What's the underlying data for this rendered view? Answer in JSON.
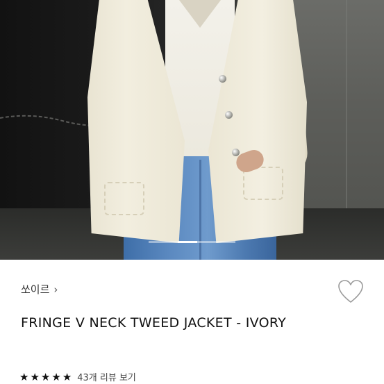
{
  "product": {
    "brand_label": "쏘이르",
    "brand_chevron": "›",
    "title": "FRINGE V NECK TWEED JACKET - IVORY",
    "rating_value": 5,
    "stars": [
      "★",
      "★",
      "★",
      "★",
      "★"
    ],
    "reviews_label": "43개 리뷰 보기"
  },
  "image_carousel": {
    "progress": 0.22
  },
  "icons": {
    "wishlist": "heart-outline-icon",
    "brand_chevron": "chevron-right-icon",
    "star": "star-filled-icon"
  },
  "colors": {
    "text_primary": "#111111",
    "text_secondary": "#333333",
    "heart_stroke": "#9a9a9a"
  }
}
